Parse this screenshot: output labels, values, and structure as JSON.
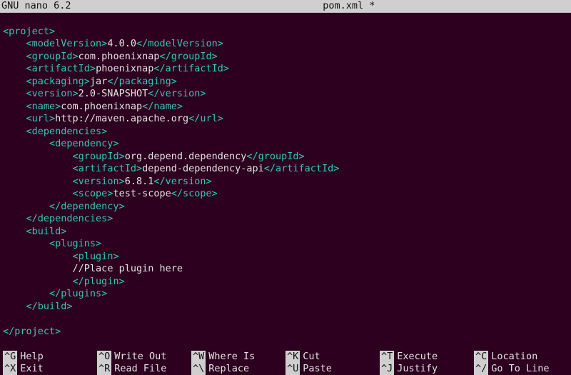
{
  "header": {
    "app": "GNU nano 6.2",
    "filename": "pom.xml *"
  },
  "xml": {
    "project_open": "<project>",
    "modelVersion_open": "<modelVersion>",
    "modelVersion_val": "4.0.0",
    "modelVersion_close": "</modelVersion>",
    "groupId_open": "<groupId>",
    "groupId_val": "com.phoenixnap",
    "groupId_close": "</groupId>",
    "artifactId_open": "<artifactId>",
    "artifactId_val": "phoenixnap",
    "artifactId_close": "</artifactId>",
    "packaging_open": "<packaging>",
    "packaging_val": "jar",
    "packaging_close": "</packaging>",
    "version_open": "<version>",
    "version_val": "2.0-SNAPSHOT",
    "version_close": "</version>",
    "name_open": "<name>",
    "name_val": "com.phoenixnap",
    "name_close": "</name>",
    "url_open": "<url>",
    "url_val": "http://maven.apache.org",
    "url_close": "</url>",
    "dependencies_open": "<dependencies>",
    "dependency_open": "<dependency>",
    "dep_groupId_open": "<groupId>",
    "dep_groupId_val": "org.depend.dependency",
    "dep_groupId_close": "</groupId>",
    "dep_artifactId_open": "<artifactId>",
    "dep_artifactId_val": "depend-dependency-api",
    "dep_artifactId_close": "</artifactId>",
    "dep_version_open": "<version>",
    "dep_version_val": "6.8.1",
    "dep_version_close": "</version>",
    "dep_scope_open": "<scope>",
    "dep_scope_val": "test-scope",
    "dep_scope_close": "</scope>",
    "dependency_close": "</dependency>",
    "dependencies_close": "</dependencies>",
    "build_open": "<build>",
    "plugins_open": "<plugins>",
    "plugin_open": "<plugin>",
    "plugin_comment": "//Place plugin here",
    "plugin_close": "</plugin>",
    "plugins_close": "</plugins>",
    "build_close": "</build>",
    "project_close": "</project>"
  },
  "shortcuts": {
    "row1": [
      {
        "key": "^G",
        "label": "Help"
      },
      {
        "key": "^O",
        "label": "Write Out"
      },
      {
        "key": "^W",
        "label": "Where Is"
      },
      {
        "key": "^K",
        "label": "Cut"
      },
      {
        "key": "^T",
        "label": "Execute"
      },
      {
        "key": "^C",
        "label": "Location"
      }
    ],
    "row2": [
      {
        "key": "^X",
        "label": "Exit"
      },
      {
        "key": "^R",
        "label": "Read File"
      },
      {
        "key": "^\\",
        "label": "Replace"
      },
      {
        "key": "^U",
        "label": "Paste"
      },
      {
        "key": "^J",
        "label": "Justify"
      },
      {
        "key": "^/",
        "label": "Go To Line"
      }
    ]
  }
}
